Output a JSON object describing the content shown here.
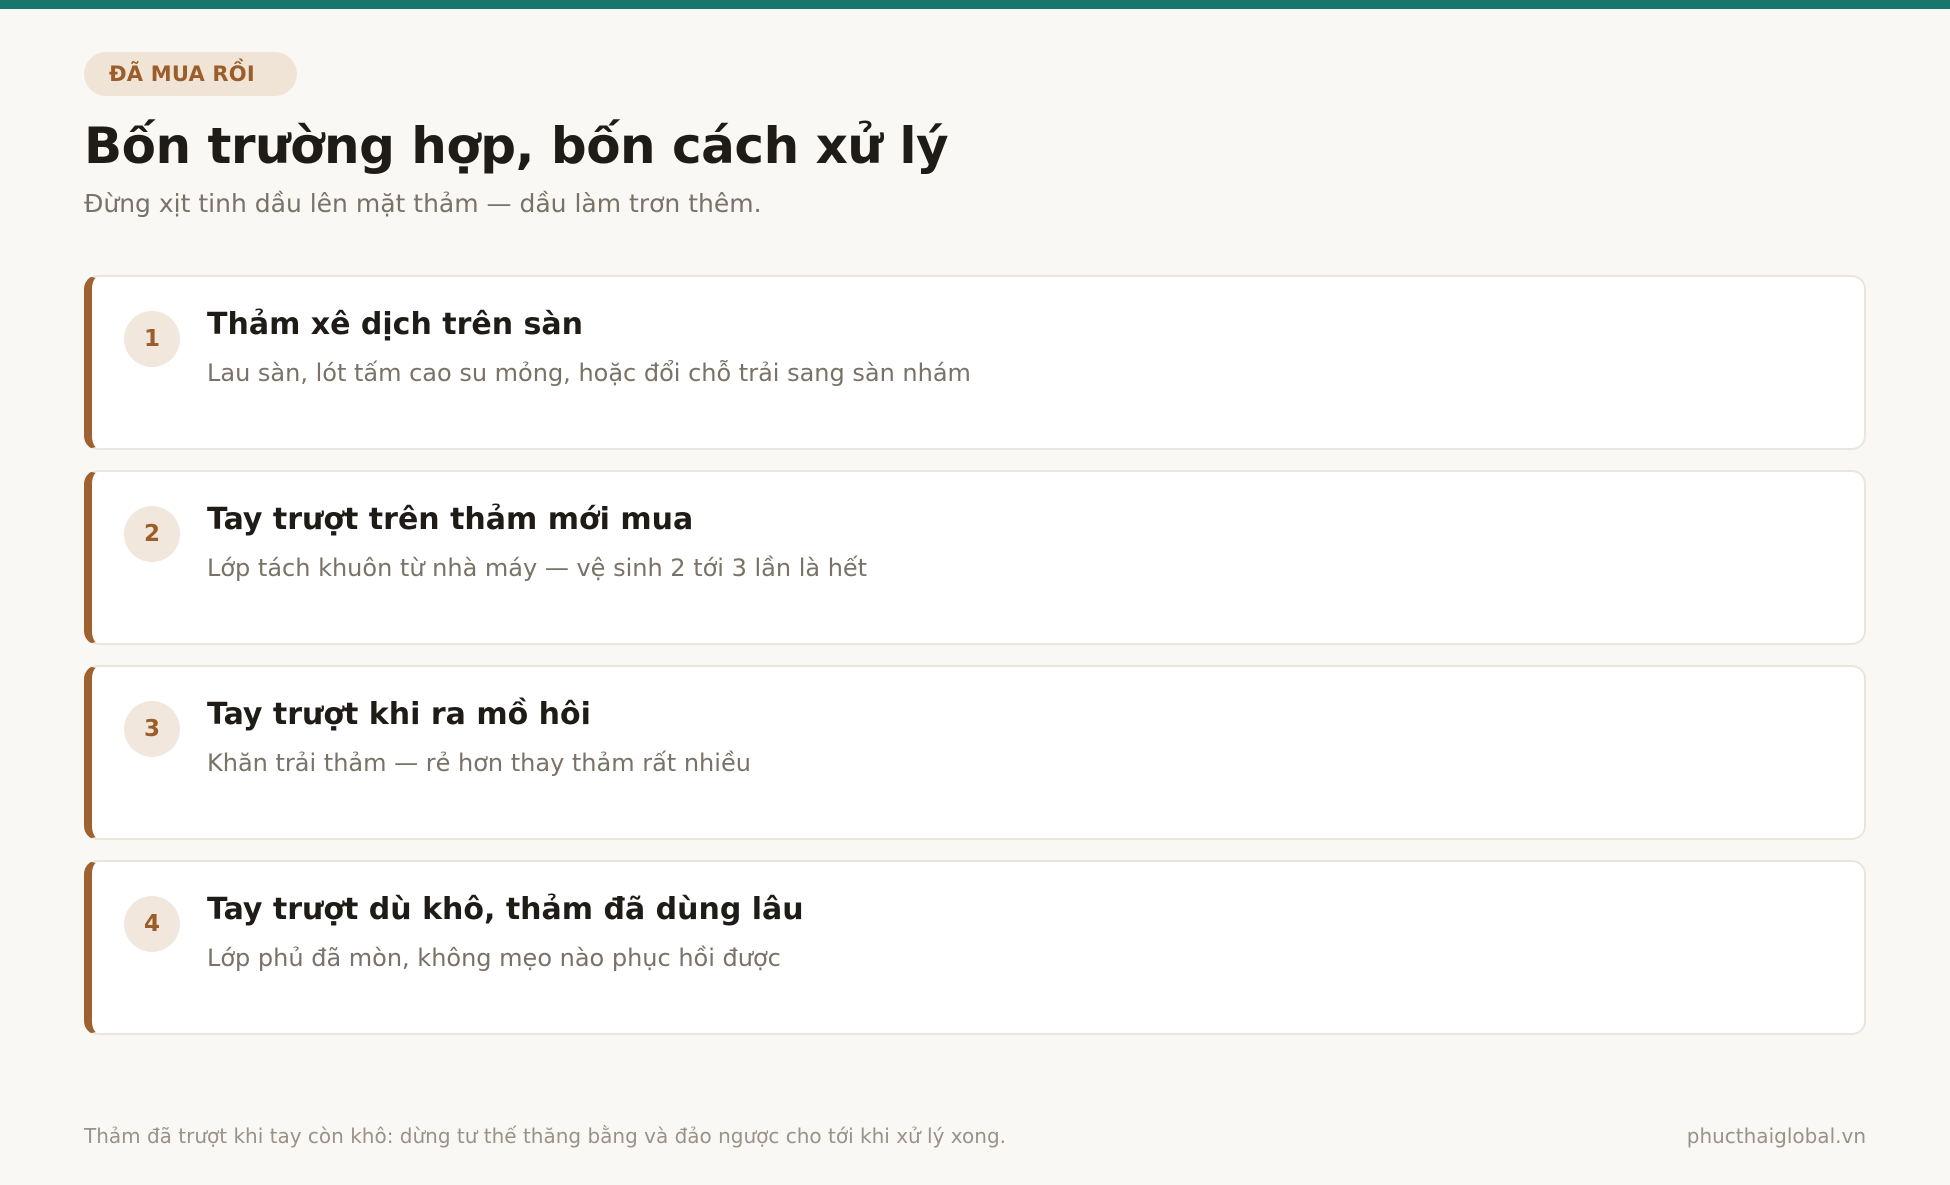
{
  "header": {
    "eyebrow": "ĐÃ MUA RỒI",
    "title": "Bốn trường hợp, bốn cách xử lý",
    "subtitle": "Đừng xịt tinh dầu lên mặt thảm — dầu làm trơn thêm."
  },
  "cases": [
    {
      "number": "1",
      "title": "Thảm xê dịch trên sàn",
      "description": "Lau sàn, lót tấm cao su mỏng, hoặc đổi chỗ trải sang sàn nhám"
    },
    {
      "number": "2",
      "title": "Tay trượt trên thảm mới mua",
      "description": "Lớp tách khuôn từ nhà máy — vệ sinh 2 tới 3 lần là hết"
    },
    {
      "number": "3",
      "title": "Tay trượt khi ra mồ hôi",
      "description": "Khăn trải thảm — rẻ hơn thay thảm rất nhiều"
    },
    {
      "number": "4",
      "title": "Tay trượt dù khô, thảm đã dùng lâu",
      "description": "Lớp phủ đã mòn, không mẹo nào phục hồi được"
    }
  ],
  "footer": {
    "note": "Thảm đã trượt khi tay còn khô: dừng tư thế thăng bằng và đảo ngược cho tới khi xử lý xong.",
    "site": "phucthaiglobal.vn"
  },
  "colors": {
    "accent_teal": "#17766e",
    "accent_brown": "#9d622f",
    "badge_bg": "#f0e4d7",
    "background": "#faf8f4"
  }
}
